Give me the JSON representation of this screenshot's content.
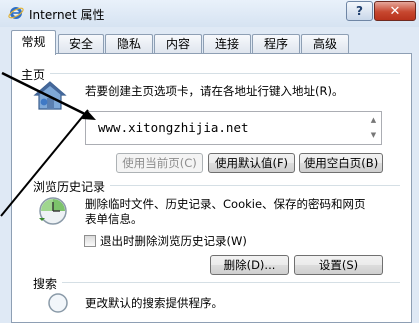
{
  "window": {
    "title": "Internet 属性",
    "help_label": "?",
    "close_label": "✕"
  },
  "tabs": [
    "常规",
    "安全",
    "隐私",
    "内容",
    "连接",
    "程序",
    "高级"
  ],
  "homepage": {
    "group_label": "主页",
    "description": "若要创建主页选项卡，请在各地址行键入地址(R)。",
    "address": "www.xitongzhijia.net",
    "use_current": "使用当前页(C)",
    "use_default": "使用默认值(F)",
    "use_blank": "使用空白页(B)"
  },
  "history": {
    "group_label": "浏览历史记录",
    "description_line1": "删除临时文件、历史记录、Cookie、保存的密码和网页",
    "description_line2": "表单信息。",
    "checkbox_label": "退出时删除浏览历史记录(W)",
    "checkbox_checked": false,
    "delete_button": "删除(D)...",
    "settings_button": "设置(S)"
  },
  "search": {
    "group_label": "搜索",
    "description": "更改默认的搜索提供程序。"
  },
  "colors": {
    "accent": "#1f3f6e",
    "close": "#c7472f"
  }
}
